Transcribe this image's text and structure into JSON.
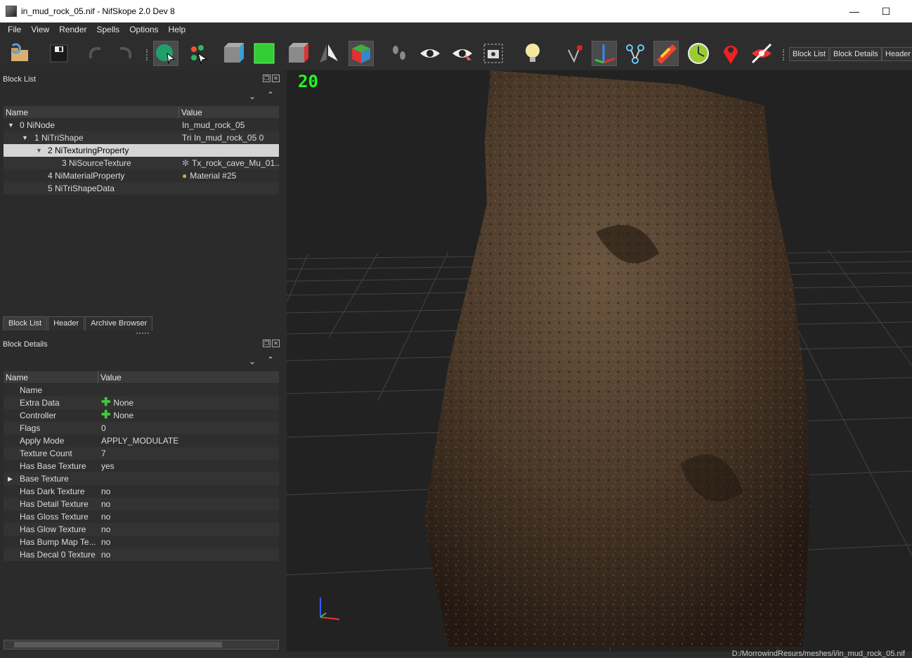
{
  "window": {
    "title": "in_mud_rock_05.nif - NifSkope 2.0 Dev 8",
    "minimize": "—",
    "maximize": "☐"
  },
  "menu": [
    "File",
    "View",
    "Render",
    "Spells",
    "Options",
    "Help"
  ],
  "toolbar": {
    "block_list": "Block List",
    "block_details": "Block Details",
    "header": "Header"
  },
  "block_list": {
    "title": "Block List",
    "columns": [
      "Name",
      "Value"
    ],
    "rows": [
      {
        "name": "0 NiNode",
        "value": "In_mud_rock_05"
      },
      {
        "name": "1 NiTriShape",
        "value": "Tri In_mud_rock_05 0"
      },
      {
        "name": "2 NiTexturingProperty",
        "value": ""
      },
      {
        "name": "3 NiSourceTexture",
        "value": "Tx_rock_cave_Mu_01..."
      },
      {
        "name": "4 NiMaterialProperty",
        "value": "Material #25"
      },
      {
        "name": "5 NiTriShapeData",
        "value": ""
      }
    ],
    "tabs": [
      "Block List",
      "Header",
      "Archive Browser"
    ]
  },
  "block_details": {
    "title": "Block Details",
    "columns": [
      "Name",
      "Value"
    ],
    "rows": [
      {
        "name": "Name",
        "value": ""
      },
      {
        "name": "Extra Data",
        "value": "None"
      },
      {
        "name": "Controller",
        "value": "None"
      },
      {
        "name": "Flags",
        "value": "0"
      },
      {
        "name": "Apply Mode",
        "value": "APPLY_MODULATE"
      },
      {
        "name": "Texture Count",
        "value": "7"
      },
      {
        "name": "Has Base Texture",
        "value": "yes"
      },
      {
        "name": "Base Texture",
        "value": ""
      },
      {
        "name": "Has Dark Texture",
        "value": "no"
      },
      {
        "name": "Has Detail Texture",
        "value": "no"
      },
      {
        "name": "Has Gloss Texture",
        "value": "no"
      },
      {
        "name": "Has Glow Texture",
        "value": "no"
      },
      {
        "name": "Has Bump Map Te...",
        "value": "no"
      },
      {
        "name": "Has Decal 0 Texture",
        "value": "no"
      }
    ]
  },
  "viewport": {
    "fps": "20"
  },
  "status": {
    "path": "D:/MorrowindResurs/meshes/i/in_mud_rock_05.nif"
  }
}
